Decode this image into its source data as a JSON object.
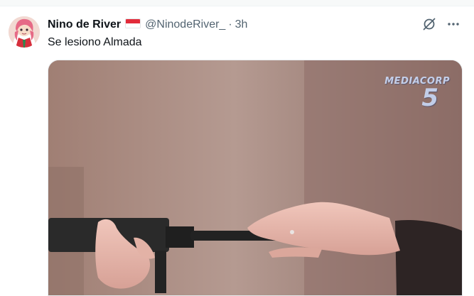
{
  "tweet": {
    "display_name": "Nino de River",
    "handle": "@NinodeRiver_",
    "separator": "·",
    "time": "3h",
    "text": "Se lesiono Almada"
  },
  "icons": {
    "flag": "monaco-indonesia-flag",
    "grok": "grok-icon",
    "more": "more-options-icon"
  },
  "media": {
    "watermark_brand": "MEDIACORP",
    "watermark_channel": "5"
  },
  "colors": {
    "text_primary": "#0f1419",
    "text_secondary": "#536471",
    "flag_red": "#e22b3a"
  }
}
